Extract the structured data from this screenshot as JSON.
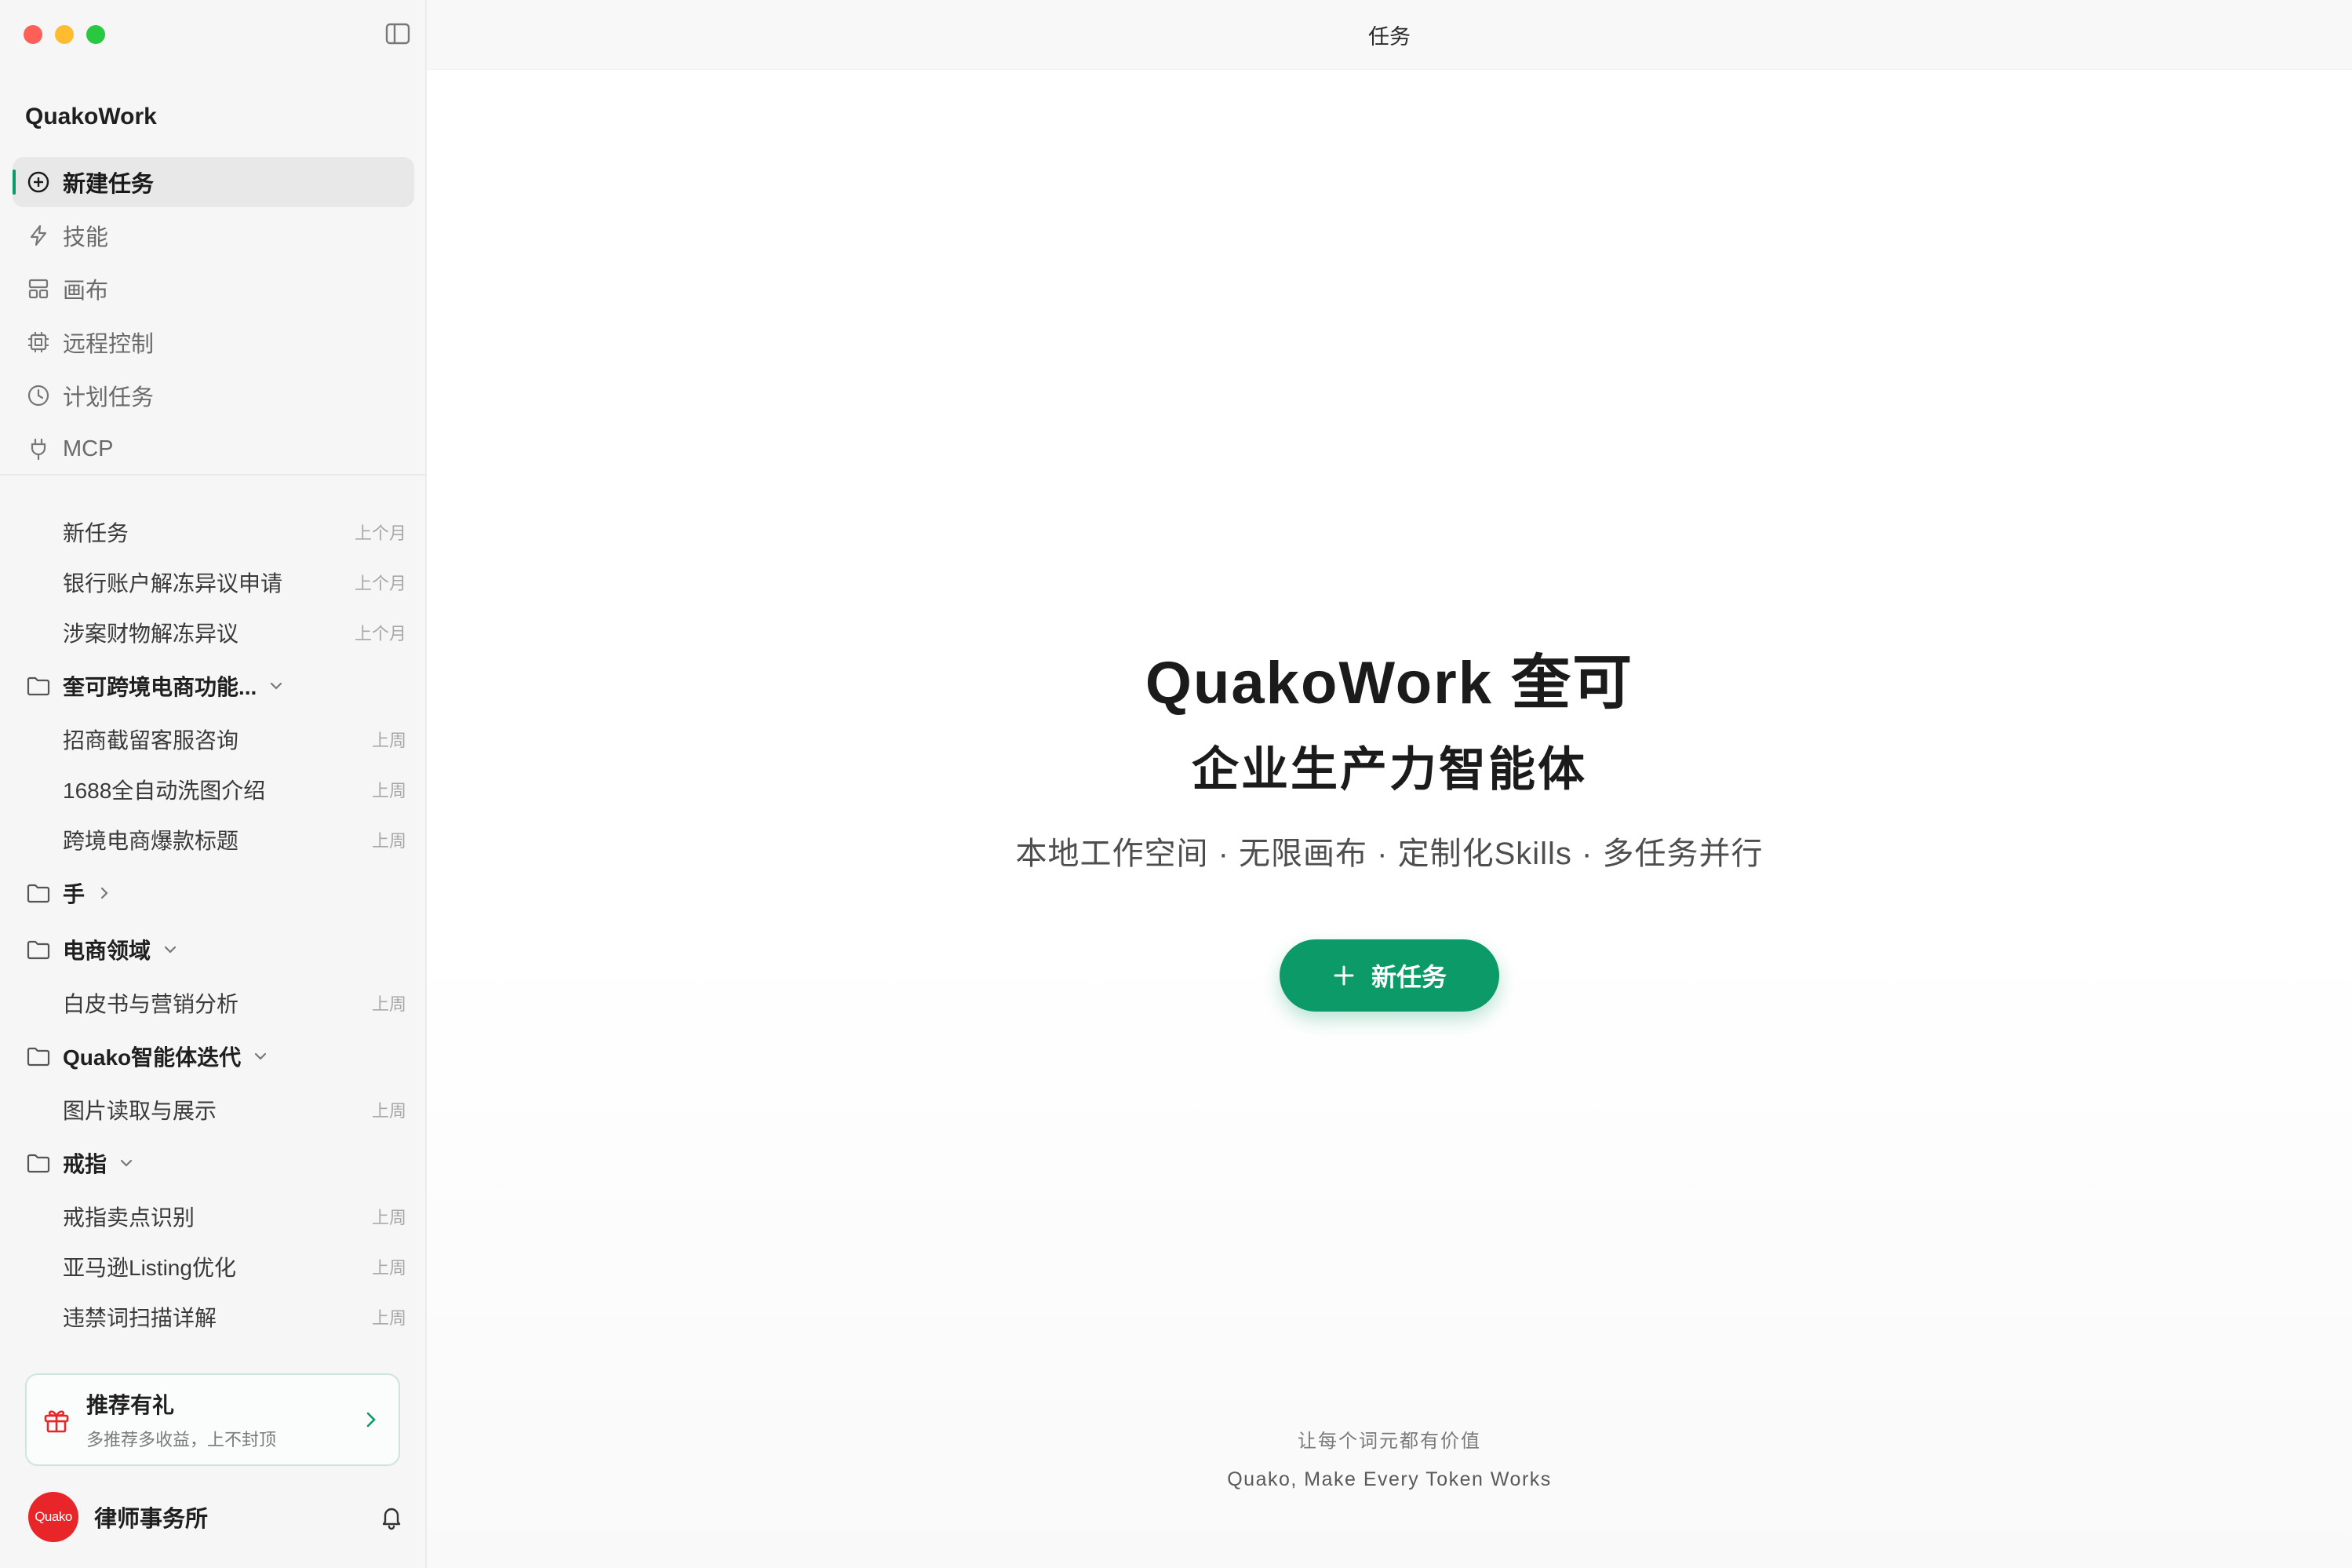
{
  "window": {
    "title": "任务"
  },
  "sidebar": {
    "app_name": "QuakoWork",
    "nav": [
      {
        "label": "新建任务",
        "icon": "plus-circle-icon",
        "active": true
      },
      {
        "label": "技能",
        "icon": "lightning-icon"
      },
      {
        "label": "画布",
        "icon": "layout-grid-icon"
      },
      {
        "label": "远程控制",
        "icon": "chip-icon"
      },
      {
        "label": "计划任务",
        "icon": "clock-icon"
      },
      {
        "label": "MCP",
        "icon": "plug-icon"
      }
    ],
    "tasks_top": [
      {
        "title": "新任务",
        "time": "上个月"
      },
      {
        "title": "银行账户解冻异议申请",
        "time": "上个月"
      },
      {
        "title": "涉案财物解冻异议",
        "time": "上个月"
      }
    ],
    "folders": [
      {
        "name": "奎可跨境电商功能...",
        "expanded": true,
        "tasks": [
          {
            "title": "招商截留客服咨询",
            "time": "上周"
          },
          {
            "title": "1688全自动洗图介绍",
            "time": "上周"
          },
          {
            "title": "跨境电商爆款标题",
            "time": "上周"
          }
        ]
      },
      {
        "name": "手",
        "expanded": false,
        "tasks": []
      },
      {
        "name": "电商领域",
        "expanded": true,
        "tasks": [
          {
            "title": "白皮书与营销分析",
            "time": "上周"
          }
        ]
      },
      {
        "name": "Quako智能体迭代",
        "expanded": true,
        "tasks": [
          {
            "title": "图片读取与展示",
            "time": "上周"
          }
        ]
      },
      {
        "name": "戒指",
        "expanded": true,
        "tasks": [
          {
            "title": "戒指卖点识别",
            "time": "上周"
          },
          {
            "title": "亚马逊Listing优化",
            "time": "上周"
          },
          {
            "title": "违禁词扫描详解",
            "time": "上周"
          }
        ]
      }
    ],
    "promo": {
      "title": "推荐有礼",
      "subtitle": "多推荐多收益，上不封顶"
    },
    "user": {
      "avatar_text": "Quako",
      "name": "律师事务所"
    }
  },
  "main": {
    "title": "QuakoWork 奎可",
    "subtitle": "企业生产力智能体",
    "tagline": "本地工作空间 · 无限画布 · 定制化Skills · 多任务并行",
    "new_task_button": "新任务",
    "footer_line1": "让每个词元都有价值",
    "footer_line2": "Quako, Make Every Token Works"
  },
  "colors": {
    "accent": "#0b9a68",
    "avatar": "#e8262a"
  }
}
